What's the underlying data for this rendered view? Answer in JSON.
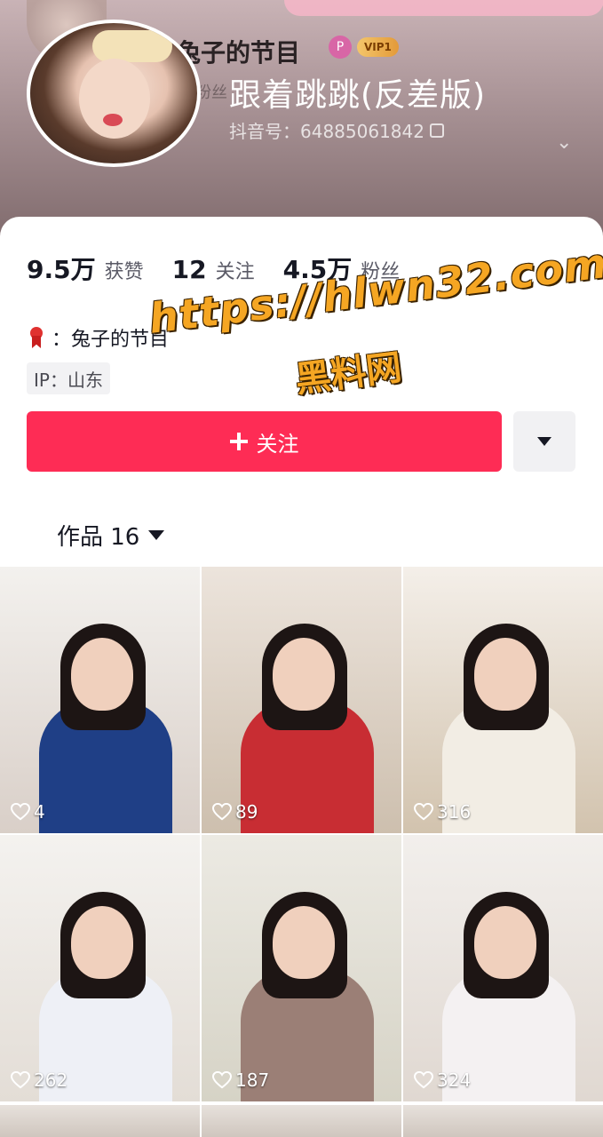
{
  "profile": {
    "ghost_name": "兔子的节目",
    "ghost_vip": "VIP1",
    "ghost_fans": "粉丝",
    "nickname": "跟着跳跳(反差版)",
    "douyin_id": "抖音号：64885061842"
  },
  "stats": [
    {
      "num": "9.5万",
      "label": "获赞"
    },
    {
      "num": "12",
      "label": "关注"
    },
    {
      "num": "4.5万",
      "label": "粉丝"
    }
  ],
  "role": {
    "text": "：兔子的节目"
  },
  "ip": "IP：山东",
  "follow_label": "关注",
  "works_tab": "作品 16",
  "watermark": {
    "url": "https://hlwn32.com",
    "name": "黑料网"
  },
  "videos": [
    {
      "likes": "4",
      "bg": "#d9cfc8",
      "top": "#f3f1ee",
      "shirt": "#1f3f86"
    },
    {
      "likes": "89",
      "bg": "#cdbfae",
      "top": "#ece4dc",
      "shirt": "#c82d33"
    },
    {
      "likes": "316",
      "bg": "#d2c3ae",
      "top": "#f4efe9",
      "shirt": "#f2ede4"
    },
    {
      "likes": "262",
      "bg": "#e3ddd6",
      "top": "#f4f2ef",
      "shirt": "#eef0f6"
    },
    {
      "likes": "187",
      "bg": "#d6d3c6",
      "top": "#eceae3",
      "shirt": "#9b7f76"
    },
    {
      "likes": "324",
      "bg": "#e0d8d1",
      "top": "#f2efec",
      "shirt": "#f4f1f2"
    }
  ],
  "colors": {
    "accent": "#fe2c55",
    "watermark": "#f5a623"
  }
}
